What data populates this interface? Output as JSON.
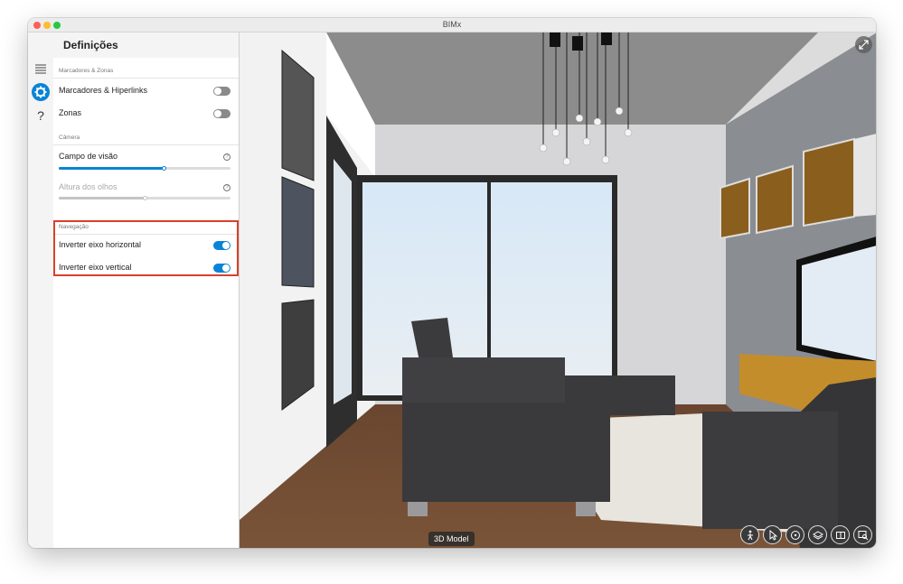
{
  "window": {
    "title": "BIMx"
  },
  "rail": {
    "items": [
      {
        "icon": "list-icon"
      },
      {
        "icon": "gear-icon",
        "active": true
      },
      {
        "icon": "help-icon",
        "glyph": "?"
      }
    ]
  },
  "panel": {
    "title": "Definições",
    "sections": {
      "markers": {
        "label": "Marcadores & Zonas",
        "rows": [
          {
            "label": "Marcadores & Hiperlinks",
            "on": false
          },
          {
            "label": "Zonas",
            "on": false
          }
        ]
      },
      "camera": {
        "label": "Câmera",
        "field_of_view": {
          "label": "Campo de visão",
          "value_percent": 61,
          "help": "?"
        },
        "eye_height": {
          "label": "Altura dos olhos",
          "value_percent": 50,
          "disabled": true,
          "help": "?"
        }
      },
      "navigation": {
        "label": "Navegação",
        "rows": [
          {
            "label": "Inverter eixo horizontal",
            "on": true
          },
          {
            "label": "Inverter eixo vertical",
            "on": true
          }
        ]
      }
    }
  },
  "viewport": {
    "mode_label": "3D Model",
    "tools": [
      "walk-icon",
      "pointer-icon",
      "orbit-icon",
      "layers-icon",
      "view-icon",
      "zoom-icon"
    ]
  },
  "colors": {
    "accent": "#0a84d6",
    "highlight": "#d9402b"
  }
}
